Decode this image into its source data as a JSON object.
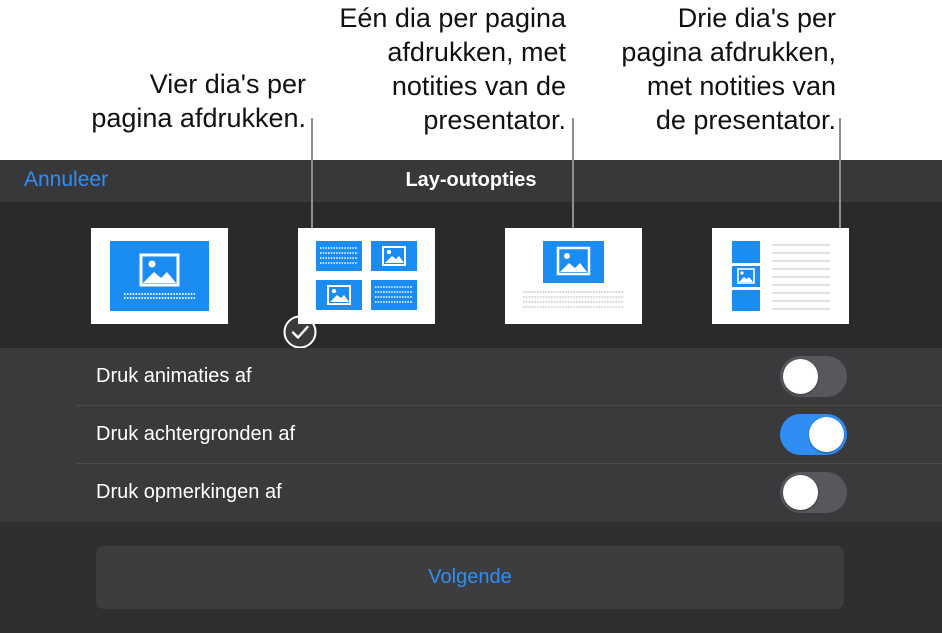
{
  "callouts": {
    "four_per_page": [
      "Vier dia's per",
      "pagina afdrukken."
    ],
    "one_per_page": [
      "Eén dia per pagina",
      "afdrukken, met",
      "notities van de",
      "presentator."
    ],
    "three_per_page": [
      "Drie dia's per",
      "pagina afdrukken,",
      "met notities van",
      "de presentator."
    ]
  },
  "navbar": {
    "cancel_label": "Annuleer",
    "title": "Lay-outopties"
  },
  "layouts": {
    "selected": "single-slide",
    "options": [
      "single-slide",
      "four-per-page",
      "one-with-notes",
      "three-with-notes"
    ]
  },
  "options": [
    {
      "label": "Druk animaties af",
      "enabled": false
    },
    {
      "label": "Druk achtergronden af",
      "enabled": true
    },
    {
      "label": "Druk opmerkingen af",
      "enabled": false
    }
  ],
  "next_button": {
    "label": "Volgende"
  },
  "colors": {
    "accent": "#2f8ef4",
    "panel": "#2f2f31",
    "thumb_blue": "#1a8cf2"
  }
}
